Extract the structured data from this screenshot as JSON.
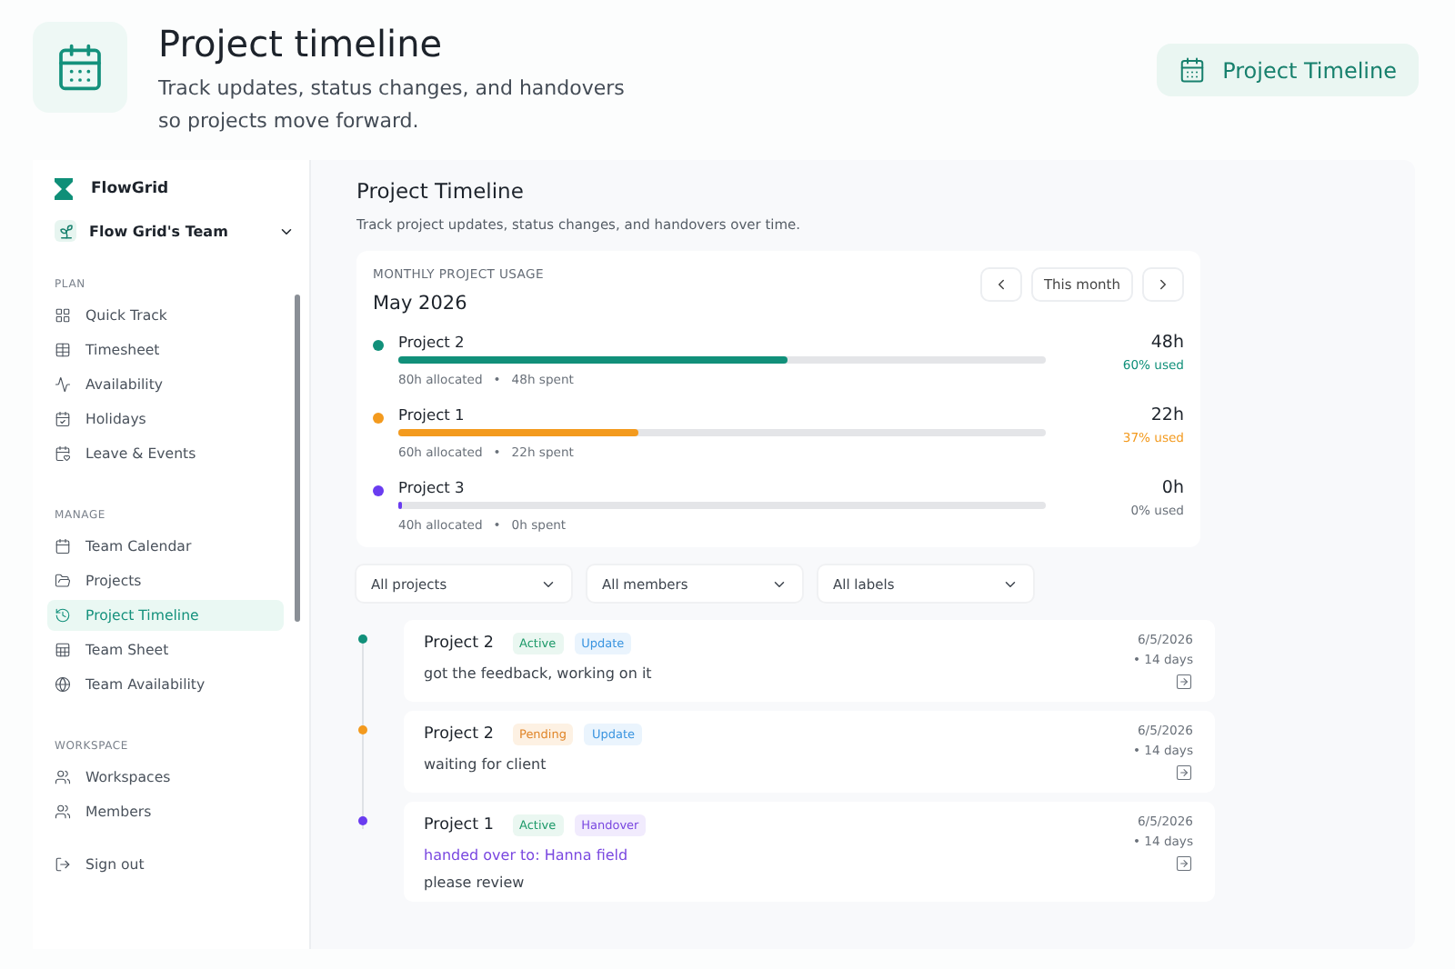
{
  "header": {
    "title": "Project timeline",
    "subtitle": "Track updates, status changes, and handovers so projects move forward.",
    "button": "Project Timeline"
  },
  "sidebar": {
    "brand": "FlowGrid",
    "team": "Flow Grid's Team",
    "sections": [
      {
        "heading": "PLAN",
        "items": [
          {
            "label": "Quick Track",
            "selected": false
          },
          {
            "label": "Timesheet",
            "selected": false
          },
          {
            "label": "Availability",
            "selected": false
          },
          {
            "label": "Holidays",
            "selected": false
          },
          {
            "label": "Leave & Events",
            "selected": false
          }
        ]
      },
      {
        "heading": "MANAGE",
        "items": [
          {
            "label": "Team Calendar",
            "selected": false
          },
          {
            "label": "Projects",
            "selected": false
          },
          {
            "label": "Project Timeline",
            "selected": true
          },
          {
            "label": "Team Sheet",
            "selected": false
          },
          {
            "label": "Team Availability",
            "selected": false
          }
        ]
      },
      {
        "heading": "WORKSPACE",
        "items": [
          {
            "label": "Workspaces",
            "selected": false
          },
          {
            "label": "Members",
            "selected": false
          }
        ]
      }
    ],
    "sign_out": "Sign out"
  },
  "page": {
    "title": "Project Timeline",
    "subtitle": "Track project updates, status changes, and handovers over time."
  },
  "usage": {
    "heading": "MONTHLY PROJECT USAGE",
    "month": "May 2026",
    "period": "This month",
    "separator": "•",
    "projects": [
      {
        "name": "Project 2",
        "color": "#11907a",
        "level": 0.6,
        "allocated": "80h allocated",
        "spent": "48h spent",
        "hours": "48h",
        "used": "60% used"
      },
      {
        "name": "Project 1",
        "color": "#f39a1e",
        "level": 0.37,
        "allocated": "60h allocated",
        "spent": "22h spent",
        "hours": "22h",
        "used": "37% used"
      },
      {
        "name": "Project 3",
        "color": "#6a3cf0",
        "level": 0,
        "allocated": "40h allocated",
        "spent": "0h spent",
        "hours": "0h",
        "used": "0% used"
      }
    ]
  },
  "filters": [
    "All projects",
    "All members",
    "All labels"
  ],
  "entries": [
    {
      "project": "Project 2",
      "color": "#11907a",
      "tags": [
        {
          "label": "Active",
          "kind": "active"
        },
        {
          "label": "Update",
          "kind": "update"
        }
      ],
      "note": "got the feedback, working on it",
      "date": "6/5/2026",
      "age": "• 14 days"
    },
    {
      "project": "Project 2",
      "color": "#f39a1e",
      "tags": [
        {
          "label": "Pending",
          "kind": "pending"
        },
        {
          "label": "Update",
          "kind": "update"
        }
      ],
      "note": "waiting for client",
      "date": "6/5/2026",
      "age": "• 14 days"
    },
    {
      "project": "Project 1",
      "color": "#6a3cf0",
      "tags": [
        {
          "label": "Active",
          "kind": "active"
        },
        {
          "label": "Handover",
          "kind": "handover"
        }
      ],
      "handover": "handed over to: Hanna field",
      "note": "please review",
      "date": "6/5/2026",
      "age": "• 14 days"
    }
  ]
}
